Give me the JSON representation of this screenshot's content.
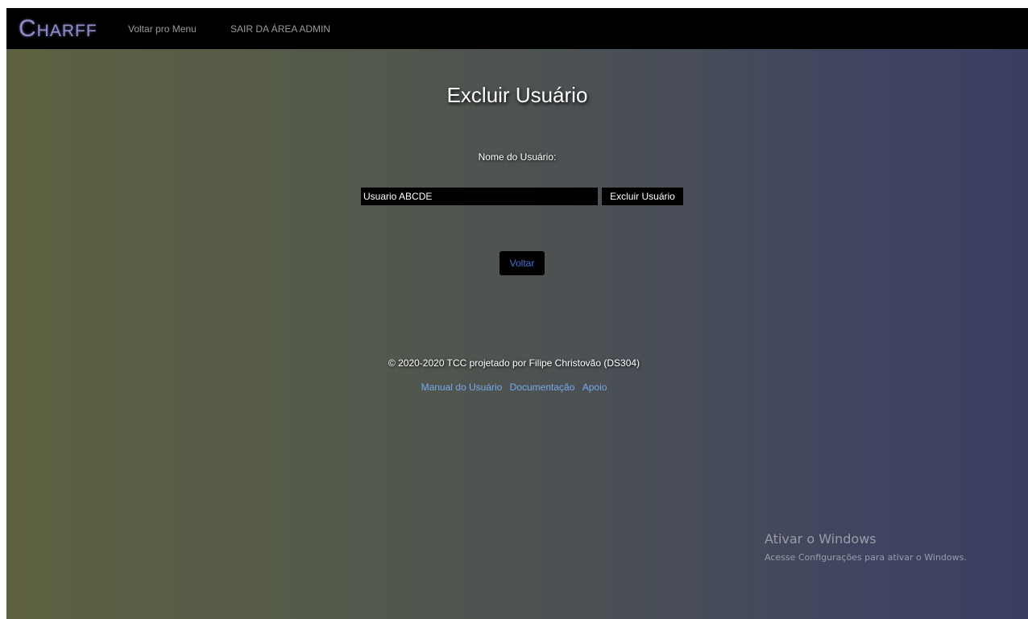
{
  "navbar": {
    "brand": "Charff",
    "menu_link": "Voltar pro Menu",
    "exit_link": "SAIR DA ÁREA ADMIN"
  },
  "main": {
    "title": "Excluir Usuário",
    "field_label": "Nome do Usuário:",
    "user_input_value": "Usuario ABCDE",
    "delete_button": "Excluir Usuário",
    "back_button": "Voltar"
  },
  "footer": {
    "copyright": "© 2020-2020 TCC projetado por Filipe Christovão (DS304)",
    "links": [
      "Manual do Usuário",
      "Documentação",
      "Apoio"
    ]
  },
  "windows_watermark": {
    "title": "Ativar o Windows",
    "subtitle": "Acesse Configurações para ativar o Windows."
  },
  "colors": {
    "navbar_bg": "#000000",
    "brand": "#8e8dc6",
    "link_blue": "#79a8ee",
    "back_button_text": "#4c6fd6"
  }
}
